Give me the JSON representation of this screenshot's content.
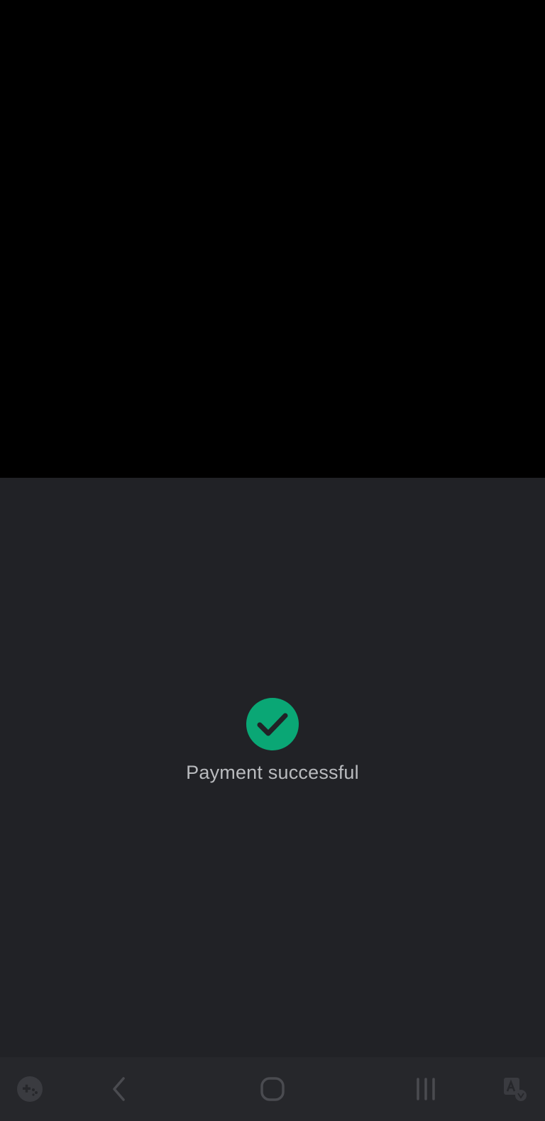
{
  "payment": {
    "status_message": "Payment successful",
    "icon": "check-circle-icon",
    "accent_color": "#0aa775"
  },
  "navigation_bar": {
    "buttons": [
      {
        "name": "game-tools",
        "icon": "gamepad-icon"
      },
      {
        "name": "back",
        "icon": "chevron-left-icon"
      },
      {
        "name": "home",
        "icon": "rounded-square-icon"
      },
      {
        "name": "recents",
        "icon": "three-lines-icon"
      },
      {
        "name": "accessibility",
        "icon": "person-assist-icon"
      }
    ]
  },
  "colors": {
    "background_top": "#000000",
    "sheet_background": "#212226",
    "navbar_background": "#26272b",
    "text": "#b9bbbe"
  }
}
